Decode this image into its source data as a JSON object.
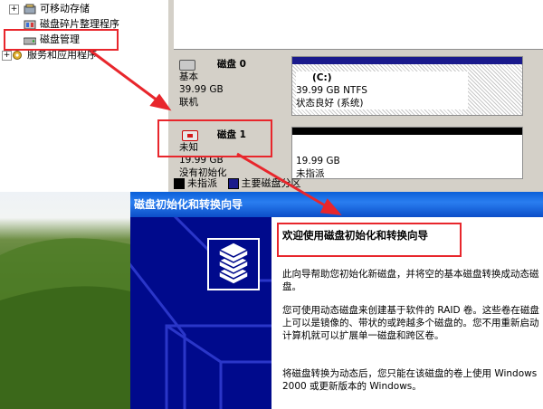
{
  "tree": {
    "items": [
      {
        "label": "可移动存储"
      },
      {
        "label": "磁盘碎片整理程序"
      },
      {
        "label": "磁盘管理"
      },
      {
        "label": "服务和应用程序"
      }
    ],
    "expander_plus": "+"
  },
  "disks": [
    {
      "title": "磁盘 0",
      "type": "基本",
      "size": "39.99 GB",
      "status": "联机",
      "partition": {
        "name": "(C:)",
        "detail": "39.99 GB NTFS",
        "state": "状态良好 (系统)"
      }
    },
    {
      "title": "磁盘 1",
      "type": "未知",
      "size": "19.99 GB",
      "status": "没有初始化",
      "partition": {
        "size": "19.99 GB",
        "state": "未指派"
      }
    }
  ],
  "legend": [
    {
      "label": "未指派",
      "color": "#000000"
    },
    {
      "label": "主要磁盘分区",
      "color": "#1a1a8c"
    }
  ],
  "wizard": {
    "title": "磁盘初始化和转换向导",
    "heading": "欢迎使用磁盘初始化和转换向导",
    "para1": "此向导帮助您初始化新磁盘，并将空的基本磁盘转换成动态磁盘。",
    "para2": "您可使用动态磁盘来创建基于软件的 RAID 卷。这些卷在磁盘上可以是镜像的、带状的或跨越多个磁盘的。您不用重新启动计算机就可以扩展单一磁盘和跨区卷。",
    "para3": "将磁盘转换为动态后，您只能在该磁盘的卷上使用 Windows 2000 或更新版本的 Windows。"
  },
  "colors": {
    "annotation": "#e8262c",
    "title_bar": "#0a5fd8",
    "wizard_side": "#000a8c"
  }
}
